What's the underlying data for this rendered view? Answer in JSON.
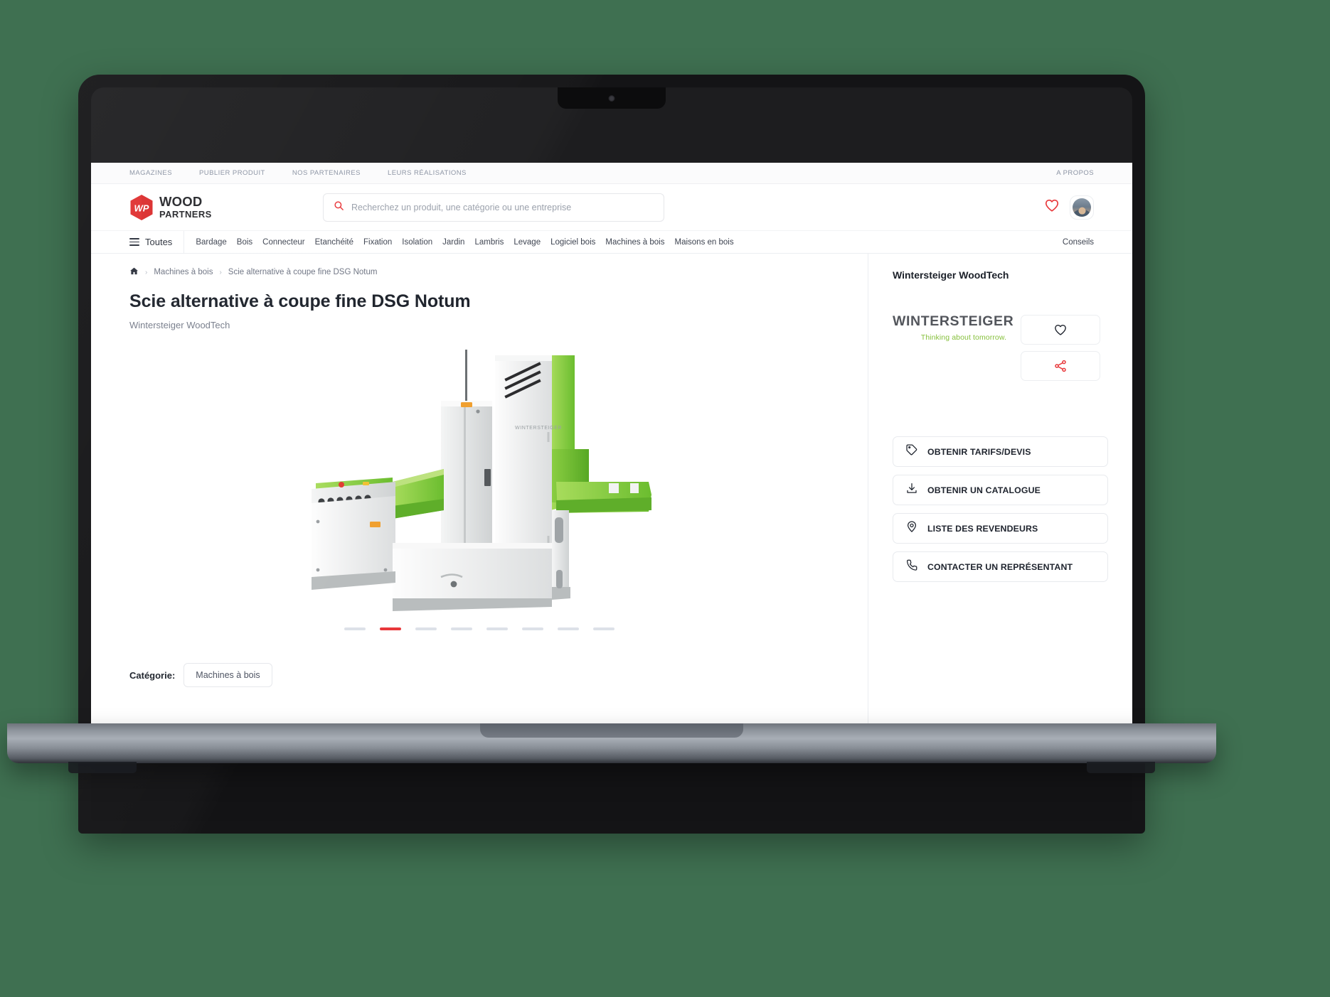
{
  "colors": {
    "background": "#3f7051",
    "accent_red": "#e8373a",
    "brand_red": "#e03131",
    "text_dark": "#1b2029",
    "text_muted": "#767c8a",
    "vendor_green": "#86c03c",
    "vendor_grey": "#53565c",
    "border": "#eceef1"
  },
  "topbar": {
    "links": [
      {
        "label": "MAGAZINES",
        "name": "topbar-link-magazines"
      },
      {
        "label": "PUBLIER PRODUIT",
        "name": "topbar-link-publier-produit"
      },
      {
        "label": "NOS PARTENAIRES",
        "name": "topbar-link-nos-partenaires"
      },
      {
        "label": "LEURS RÉALISATIONS",
        "name": "topbar-link-leurs-realisations"
      }
    ],
    "right_link": "A PROPOS"
  },
  "header": {
    "logo": {
      "mark_text": "WP",
      "line1": "WOOD",
      "line2": "PARTNERS",
      "icon": "wood-partners-hexagon-logo"
    },
    "search": {
      "placeholder": "Recherchez un produit, une catégorie ou une entreprise",
      "value": "",
      "icon": "search-icon"
    },
    "favorites_icon": "heart-icon",
    "avatar_icon": "user-avatar"
  },
  "navbar": {
    "all_label": "Toutes",
    "menu_icon": "hamburger-icon",
    "items": [
      "Bardage",
      "Bois",
      "Connecteur",
      "Etanchéité",
      "Fixation",
      "Isolation",
      "Jardin",
      "Lambris",
      "Levage",
      "Logiciel bois",
      "Machines à bois",
      "Maisons en bois"
    ],
    "right_label": "Conseils"
  },
  "breadcrumb": {
    "home_icon": "home-icon",
    "items": [
      "Machines à bois",
      "Scie alternative à coupe fine DSG Notum"
    ],
    "separator": "›"
  },
  "product": {
    "title": "Scie alternative à coupe fine DSG Notum",
    "manufacturer": "Wintersteiger WoodTech",
    "image_alt": "Scie alternative à coupe fine DSG Notum",
    "carousel": {
      "total": 8,
      "active_index": 1
    },
    "category_label": "Catégorie:",
    "category_value": "Machines à bois"
  },
  "sidebar": {
    "vendor_name": "Wintersteiger WoodTech",
    "vendor_logo": {
      "wordmark": "WINTERSTEIGER",
      "tagline": "Thinking about tomorrow.",
      "icon": "wintersteiger-logo"
    },
    "icon_buttons": [
      {
        "name": "favorite-button",
        "icon": "heart-icon"
      },
      {
        "name": "share-button",
        "icon": "share-icon"
      }
    ],
    "actions": [
      {
        "label": "OBTENIR TARIFS/DEVIS",
        "icon": "tag-icon",
        "name": "get-quote-button"
      },
      {
        "label": "OBTENIR UN CATALOGUE",
        "icon": "download-icon",
        "name": "get-catalog-button"
      },
      {
        "label": "LISTE DES REVENDEURS",
        "icon": "map-pin-icon",
        "name": "dealer-list-button"
      },
      {
        "label": "CONTACTER UN REPRÉSENTANT",
        "icon": "phone-icon",
        "name": "contact-rep-button"
      }
    ]
  }
}
